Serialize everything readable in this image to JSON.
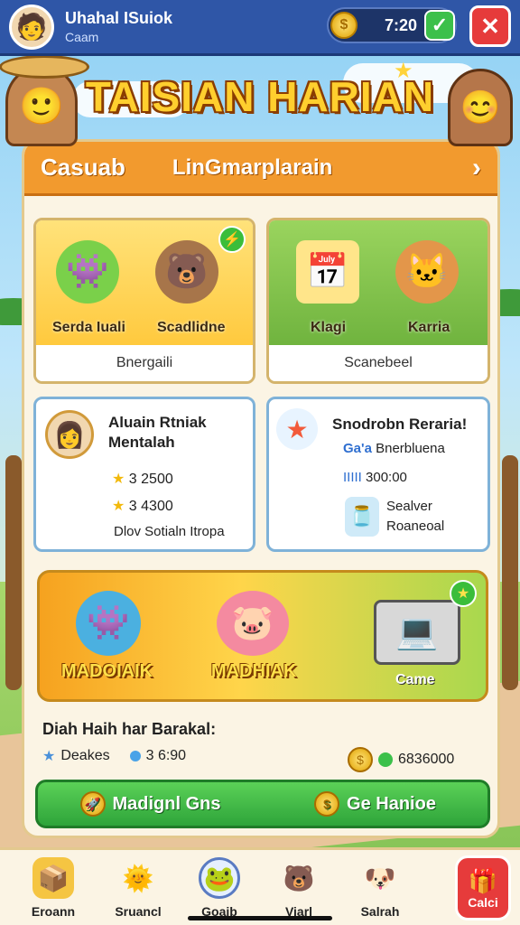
{
  "topbar": {
    "player_name": "Uhahal ISuiok",
    "player_sub": "Caam",
    "coin_value": "7:20",
    "avatar_icon": "player-avatar-icon",
    "confirm_icon": "check-icon",
    "close_icon": "close-icon"
  },
  "banner": {
    "title": "TAISIAN HARIAN"
  },
  "panel": {
    "tab_left": "Casuab",
    "tab_right": "LinGmarplarain",
    "cards": [
      {
        "label_a": "Serda Iuali",
        "label_b": "Scadlidne",
        "footer": "Bnergaili",
        "bg": "#ffd85e"
      },
      {
        "label_a": "Klagi",
        "label_b": "Karria",
        "footer": "Scanebeel",
        "bg": "#8fcb52"
      }
    ],
    "info_left": {
      "title_1": "Aluain Rtniak",
      "title_2": "Mentalah",
      "row1": "3 2500",
      "row2": "3 4300",
      "row3": "Dlov Sotialn Itropa"
    },
    "info_right": {
      "title": "Snodrobn Reraria!",
      "row1": "Bnerbluena",
      "row2": "300:00",
      "row3_a": "Sealver",
      "row3_b": "Roaneoal",
      "row1_prefix": "Ga'a",
      "row2_prefix": "IIIII"
    },
    "promo": {
      "label_1": "MADOIAIK",
      "label_2": "MADHIAK",
      "label_3": "Came"
    },
    "summary": {
      "title": "Diah Haih har Barakal:",
      "deals": "Deakes",
      "deals_value": "3 6:90",
      "coins_value": "6836000"
    },
    "cta": {
      "left": "Madignl Gns",
      "right": "Ge Hanioe"
    }
  },
  "navbar": {
    "items": [
      {
        "label": "Eroann",
        "icon": "treasure-box-icon"
      },
      {
        "label": "Sruancl",
        "icon": "sun-icon"
      },
      {
        "label": "Goaib",
        "icon": "character-icon"
      },
      {
        "label": "Viarl",
        "icon": "bear-icon"
      },
      {
        "label": "Salrah",
        "icon": "pet-icon"
      }
    ],
    "cta_label": "Calci",
    "cta_icon": "box-icon"
  },
  "colors": {
    "topbar": "#2f56a7",
    "accent": "#f29a2e",
    "close": "#e63b3b",
    "cta": "#3cc04a"
  }
}
